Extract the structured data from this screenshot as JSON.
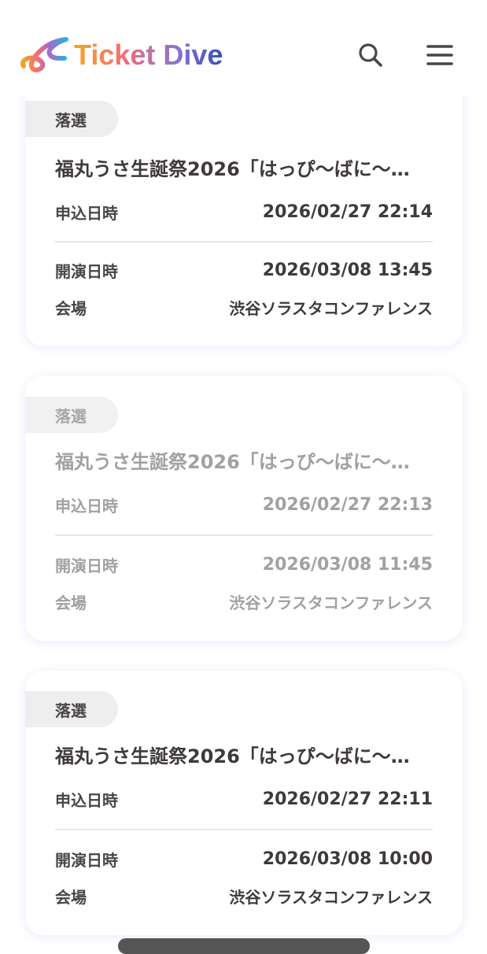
{
  "header": {
    "logo_text": "Ticket Dive",
    "logo_gradient": [
      "#f6a623",
      "#f26b7a",
      "#c877c9",
      "#5a6fd8",
      "#2ab0e6"
    ],
    "search_icon": "search-icon",
    "menu_icon": "hamburger-menu-icon"
  },
  "cards": [
    {
      "status": "落選",
      "title": "福丸うさ生誕祭2026「はっぴ〜ばに〜…",
      "applied_label": "申込日時",
      "applied_value": "2026/02/27 22:14",
      "event_label": "開演日時",
      "event_value": "2026/03/08 13:45",
      "venue_label": "会場",
      "venue_value": "渋谷ソラスタコンファレンス"
    },
    {
      "status": "落選",
      "title": "福丸うさ生誕祭2026「はっぴ〜ばに〜…",
      "applied_label": "申込日時",
      "applied_value": "2026/02/27 22:13",
      "event_label": "開演日時",
      "event_value": "2026/03/08 11:45",
      "venue_label": "会場",
      "venue_value": "渋谷ソラスタコンファレンス"
    },
    {
      "status": "落選",
      "title": "福丸うさ生誕祭2026「はっぴ〜ばに〜…",
      "applied_label": "申込日時",
      "applied_value": "2026/02/27 22:11",
      "event_label": "開演日時",
      "event_value": "2026/03/08 10:00",
      "venue_label": "会場",
      "venue_value": "渋谷ソラスタコンファレンス"
    }
  ]
}
